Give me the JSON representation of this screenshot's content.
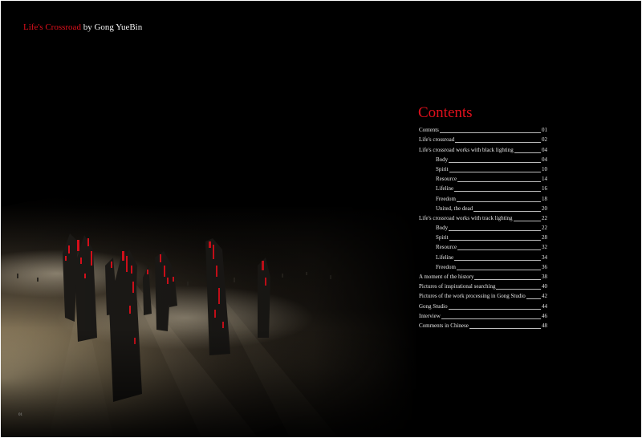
{
  "header": {
    "title_red": "Life's Crossroad",
    "title_white": "by Gong YueBin"
  },
  "page_number": "01",
  "toc": {
    "title": "Contents",
    "entries": [
      {
        "label": "Contents",
        "page": "01",
        "indent": false
      },
      {
        "label": "Life's crossroad",
        "page": "02",
        "indent": false
      },
      {
        "label": "Life's crossroad works with black lighting",
        "page": "04",
        "indent": false
      },
      {
        "label": "Body",
        "page": "04",
        "indent": true
      },
      {
        "label": "Spirit",
        "page": "10",
        "indent": true
      },
      {
        "label": "Resource",
        "page": "14",
        "indent": true
      },
      {
        "label": "Lifeline",
        "page": "16",
        "indent": true
      },
      {
        "label": "Freedom",
        "page": "18",
        "indent": true
      },
      {
        "label": "United, the dead",
        "page": "20",
        "indent": true
      },
      {
        "label": "Life's crossroad works with track lighting",
        "page": "22",
        "indent": false
      },
      {
        "label": "Body",
        "page": "22",
        "indent": true
      },
      {
        "label": "Spirit",
        "page": "28",
        "indent": true
      },
      {
        "label": "Resource",
        "page": "32",
        "indent": true
      },
      {
        "label": "Lifeline",
        "page": "34",
        "indent": true
      },
      {
        "label": "Freedom",
        "page": "36",
        "indent": true
      },
      {
        "label": "A moment of the history",
        "page": "38",
        "indent": false
      },
      {
        "label": "Pictures of inspirational searching",
        "page": "40",
        "indent": false
      },
      {
        "label": "Pictures of the work processing in Gong Studio",
        "page": "42",
        "indent": false
      },
      {
        "label": "Gong Studio",
        "page": "44",
        "indent": false
      },
      {
        "label": "Interview",
        "page": "46",
        "indent": false
      },
      {
        "label": "Comments in Chinese",
        "page": "48",
        "indent": false
      }
    ]
  },
  "colors": {
    "background": "#000000",
    "accent_red": "#e0101c",
    "text_light": "#e6e6e6"
  }
}
